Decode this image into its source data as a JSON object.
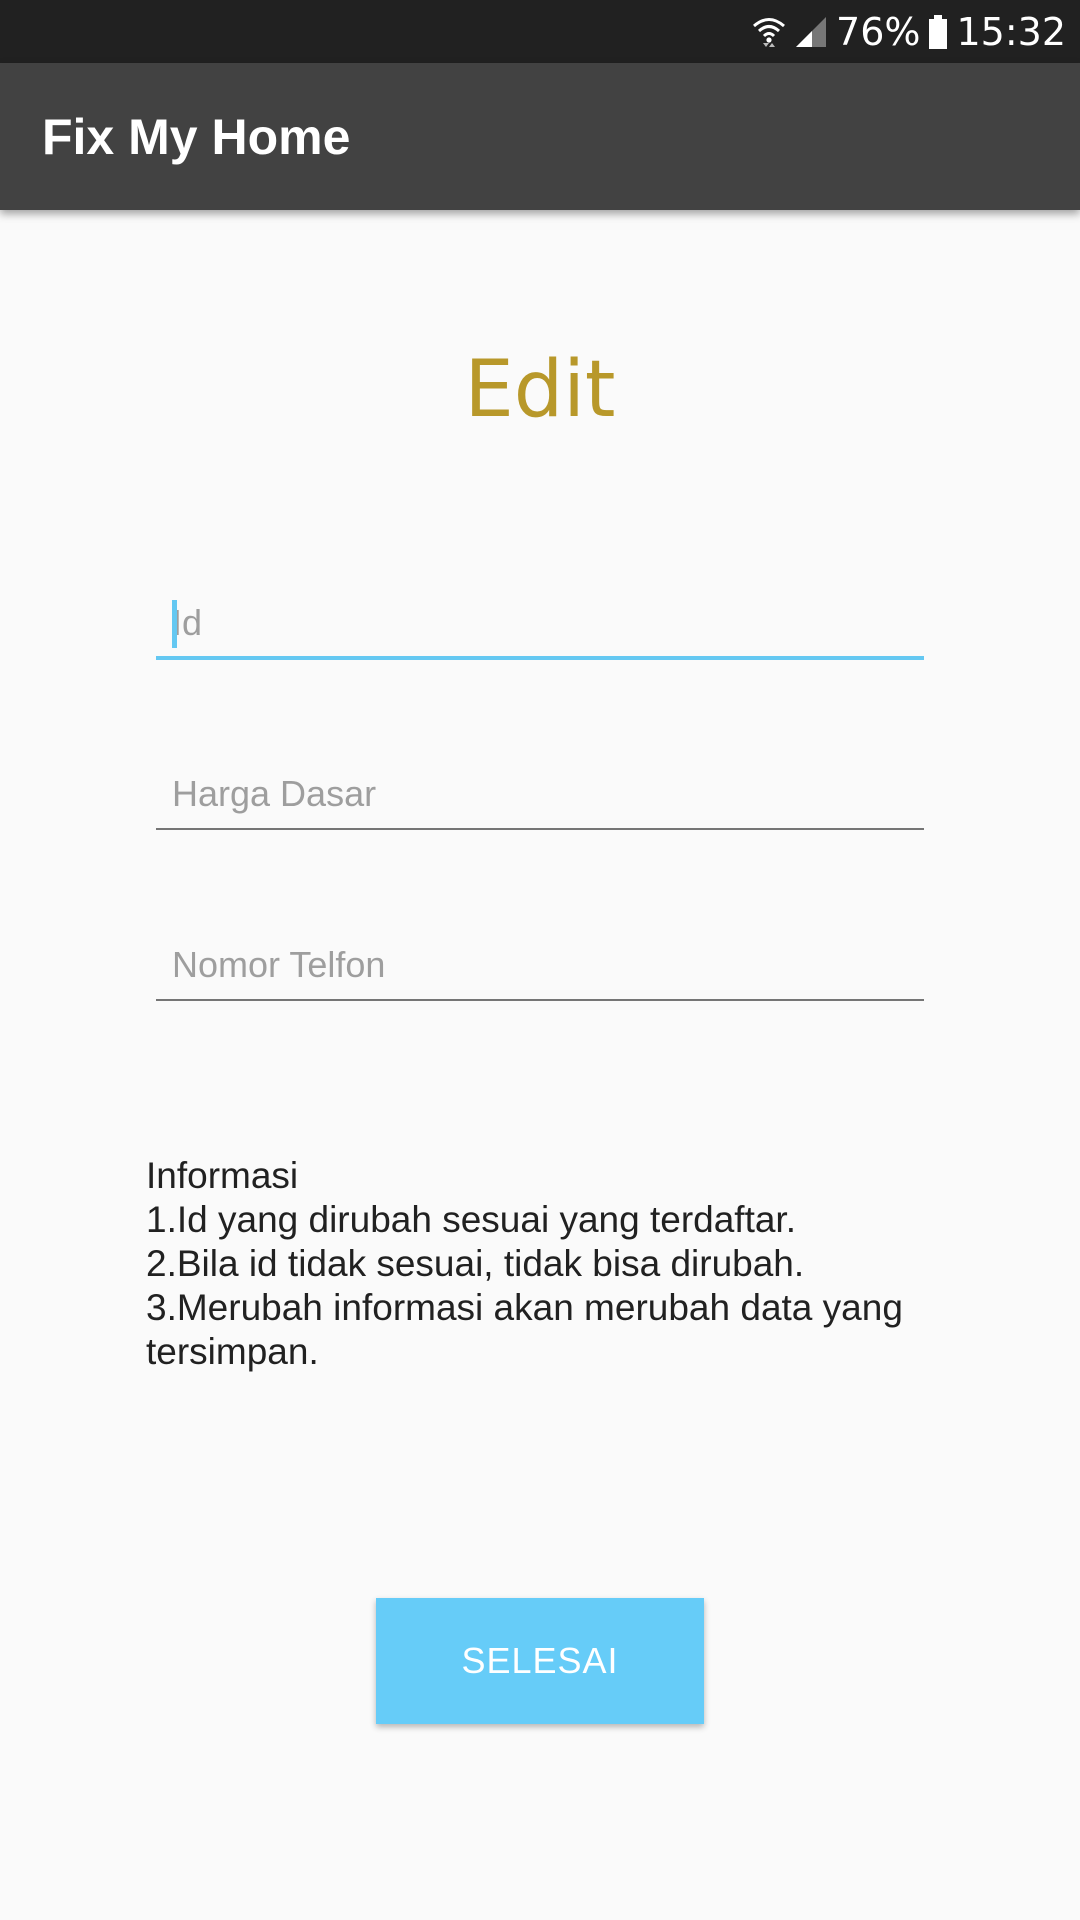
{
  "status_bar": {
    "battery": "76%",
    "time": "15:32",
    "icons": [
      "wifi-icon",
      "signal-icon",
      "battery-icon"
    ]
  },
  "app_bar": {
    "title": "Fix My Home",
    "color": "#424242"
  },
  "page": {
    "title": "Edit",
    "title_color": "#b8982a"
  },
  "form": {
    "id_placeholder": "Id",
    "id_value": "",
    "harga_placeholder": "Harga Dasar",
    "harga_value": "",
    "telfon_placeholder": "Nomor Telfon",
    "telfon_value": "",
    "accent_color": "#64c8f2"
  },
  "info": {
    "heading": "Informasi",
    "line1": "1.Id yang dirubah sesuai yang terdaftar.",
    "line2": "2.Bila id tidak sesuai, tidak bisa dirubah.",
    "line3": "3.Merubah informasi akan merubah data yang tersimpan."
  },
  "actions": {
    "done_label": "SELESAI",
    "button_color": "#66ccf8"
  }
}
